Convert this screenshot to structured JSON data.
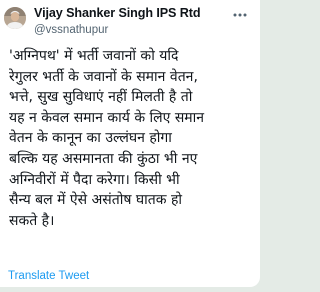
{
  "tweet": {
    "author_name": "Vijay Shanker Singh IPS Rtd",
    "author_handle": "@vssnathupur",
    "avatar_icon": "avatar-photo",
    "more_icon": "more-options-icon",
    "body_lines": [
      "'अग्निपथ' में भर्ती जवानों को यदि",
      "रेगुलर भर्ती के जवानों के समान वेतन,",
      "भत्ते, सुख सुविधाएं नहीं मिलती है तो",
      "यह न केवल समान कार्य के लिए समान",
      "वेतन के कानून का उल्लंघन होगा",
      "बल्कि यह असमानता की कुंठा भी नए",
      "अग्निवीरों में पैदा करेगा। किसी भी",
      "सैन्य बल में ऐसे असंतोष घातक हो",
      "सकते है।"
    ],
    "translate_label": "Translate Tweet"
  },
  "colors": {
    "text": "#0f1419",
    "secondary_text": "#536471",
    "link": "#1d9bf0",
    "background": "#e4ebe6",
    "card": "#ffffff"
  }
}
